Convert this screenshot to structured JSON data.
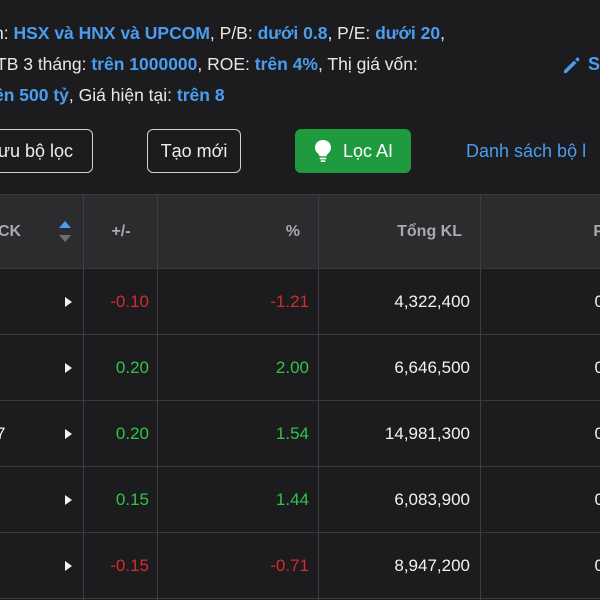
{
  "criteria": {
    "line1": [
      {
        "t": "n: ",
        "hl": false
      },
      {
        "t": "HSX và HNX và UPCOM",
        "hl": true
      },
      {
        "t": ", P/B: ",
        "hl": false
      },
      {
        "t": "dưới 0.8",
        "hl": true
      },
      {
        "t": ", P/E: ",
        "hl": false
      },
      {
        "t": "dưới 20",
        "hl": true
      },
      {
        "t": ",",
        "hl": false
      }
    ],
    "line2": [
      {
        "t": "TB 3 tháng: ",
        "hl": false
      },
      {
        "t": "trên 1000000",
        "hl": true
      },
      {
        "t": ", ROE: ",
        "hl": false
      },
      {
        "t": "trên 4%",
        "hl": true
      },
      {
        "t": ", Thị giá vốn:",
        "hl": false
      }
    ],
    "line3": [
      {
        "t": "ên 500 tỷ",
        "hl": true
      },
      {
        "t": ", Giá hiện tại: ",
        "hl": false
      },
      {
        "t": "trên 8",
        "hl": true
      }
    ]
  },
  "edit_label": "S",
  "buttons": {
    "save_filter": "ưu bộ lọc",
    "create_new": "Tạo mới",
    "ai_filter": "Lọc AI",
    "filter_list": "Danh sách bộ l"
  },
  "table": {
    "headers": {
      "ck": "CK",
      "change": "+/-",
      "percent": "%",
      "volume": "Tổng KL",
      "next": "P"
    },
    "rows": [
      {
        "ck": "",
        "change": "-0.10",
        "percent": "-1.21",
        "volume": "4,322,400",
        "next": "0",
        "dir": "down"
      },
      {
        "ck": "",
        "change": "0.20",
        "percent": "2.00",
        "volume": "6,646,500",
        "next": "0",
        "dir": "up"
      },
      {
        "ck": "7",
        "change": "0.20",
        "percent": "1.54",
        "volume": "14,981,300",
        "next": "0",
        "dir": "up"
      },
      {
        "ck": "",
        "change": "0.15",
        "percent": "1.44",
        "volume": "6,083,900",
        "next": "0",
        "dir": "up"
      },
      {
        "ck": "",
        "change": "-0.15",
        "percent": "-0.71",
        "volume": "8,947,200",
        "next": "0",
        "dir": "down"
      }
    ]
  },
  "colors": {
    "accent": "#4a9df0",
    "up": "#2fc44a",
    "down": "#d22d2d",
    "ai_button": "#1f9a3e"
  }
}
